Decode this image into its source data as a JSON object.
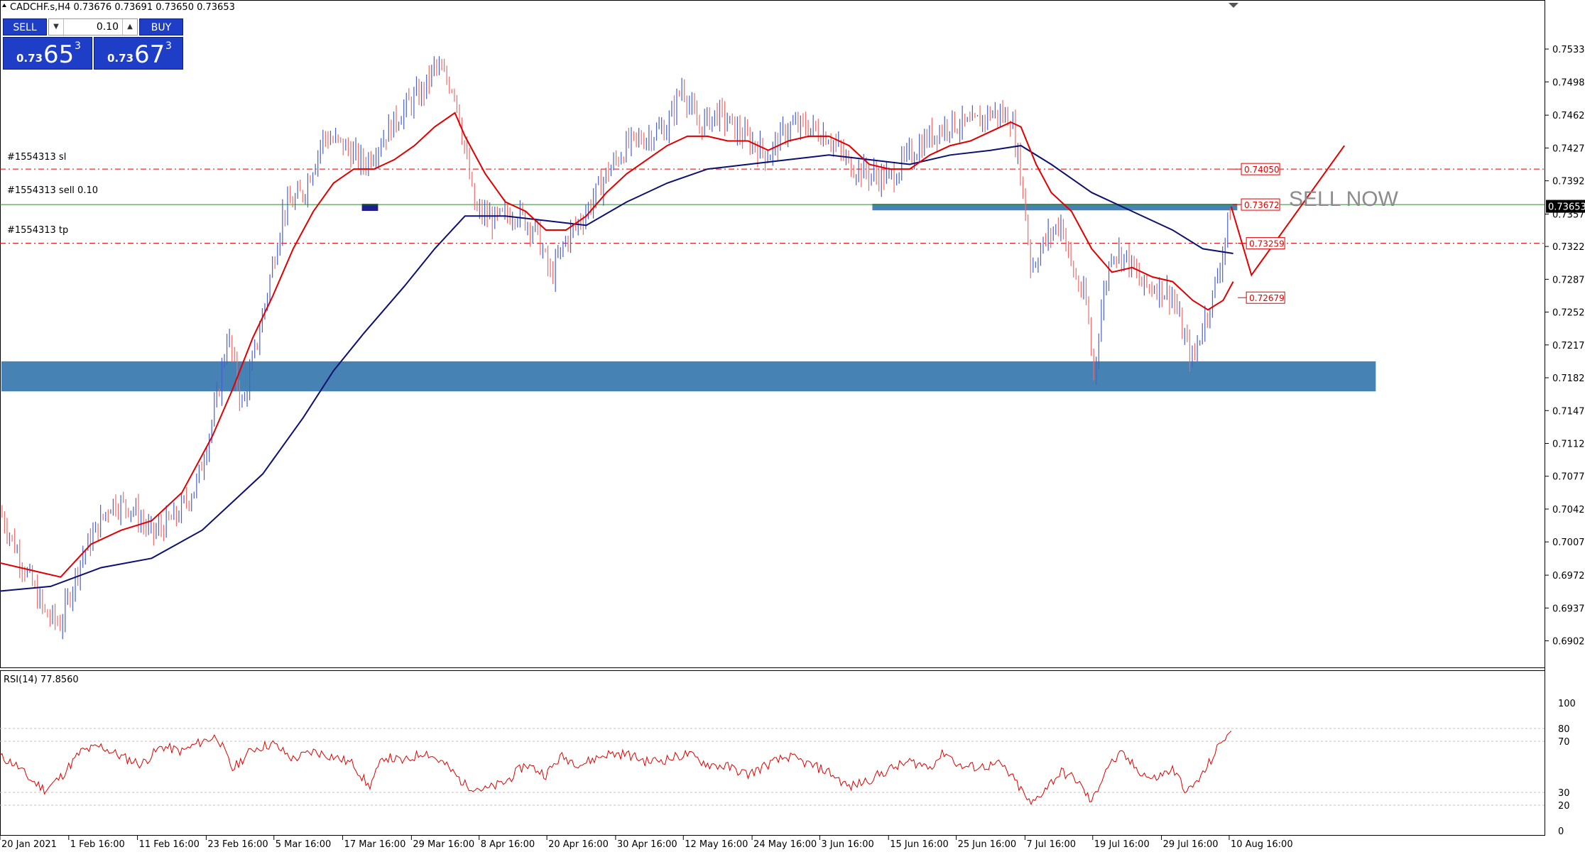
{
  "header": {
    "symbol_info": "CADCHF.s,H4  0.73676 0.73691 0.73650 0.73653"
  },
  "trade_panel": {
    "sell_label": "SELL",
    "buy_label": "BUY",
    "lot": "0.10",
    "sell_prefix": "0.73",
    "sell_big": "65",
    "sell_sup": "3",
    "buy_prefix": "0.73",
    "buy_big": "67",
    "buy_sup": "3"
  },
  "orders": {
    "sl_label": "#1554313 sl",
    "sell_label": "#1554313 sell 0.10",
    "tp_label": "#1554313 tp"
  },
  "annotations": {
    "sell_now": "SELL NOW",
    "tag_sl": "0.74050",
    "tag_entry": "0.73672",
    "tag_tp": "0.73259",
    "tag_low": "0.72679",
    "current_price": "0.73653"
  },
  "rsi": {
    "label": "RSI(14) 77.8560"
  },
  "colors": {
    "bull_candle": "#4a5fd0",
    "bear_candle": "#f06a6a",
    "ema_fast": "#e00000",
    "ma_slow": "#0c1070",
    "zone_blue": "#4682b4",
    "rsi_line": "#e00000",
    "current_price_bg": "#000000"
  },
  "chart_data": [
    {
      "type": "line",
      "subtype": "candlestick",
      "ylim": [
        0.6885,
        0.7555
      ],
      "y_ticks": [
        "0.75330",
        "0.74980",
        "0.74625",
        "0.74275",
        "0.73925",
        "0.73570",
        "0.73225",
        "0.72875",
        "0.72525",
        "0.72175",
        "0.71825",
        "0.71475",
        "0.71125",
        "0.70775",
        "0.70425",
        "0.70075",
        "0.69720",
        "0.69370",
        "0.69020"
      ],
      "x_ticks": [
        "20 Jan 2021",
        "1 Feb 16:00",
        "11 Feb 16:00",
        "23 Feb 16:00",
        "5 Mar 16:00",
        "17 Mar 16:00",
        "29 Mar 16:00",
        "8 Apr 16:00",
        "20 Apr 16:00",
        "30 Apr 16:00",
        "12 May 16:00",
        "24 May 16:00",
        "3 Jun 16:00",
        "15 Jun 16:00",
        "25 Jun 16:00",
        "7 Jul 16:00",
        "19 Jul 16:00",
        "29 Jul 16:00",
        "10 Aug 16:00"
      ],
      "price_path": [
        [
          0,
          0.704
        ],
        [
          20,
          0.699
        ],
        [
          45,
          0.693
        ],
        [
          60,
          0.692
        ],
        [
          80,
          0.699
        ],
        [
          110,
          0.705
        ],
        [
          130,
          0.7045
        ],
        [
          150,
          0.7015
        ],
        [
          175,
          0.7035
        ],
        [
          195,
          0.707
        ],
        [
          215,
          0.716
        ],
        [
          225,
          0.723
        ],
        [
          240,
          0.715
        ],
        [
          260,
          0.725
        ],
        [
          280,
          0.736
        ],
        [
          300,
          0.738
        ],
        [
          320,
          0.744
        ],
        [
          340,
          0.743
        ],
        [
          360,
          0.741
        ],
        [
          380,
          0.744
        ],
        [
          400,
          0.747
        ],
        [
          420,
          0.749
        ],
        [
          430,
          0.7515
        ],
        [
          450,
          0.749
        ],
        [
          470,
          0.736
        ],
        [
          490,
          0.735
        ],
        [
          510,
          0.736
        ],
        [
          530,
          0.734
        ],
        [
          545,
          0.729
        ],
        [
          560,
          0.733
        ],
        [
          580,
          0.736
        ],
        [
          600,
          0.74
        ],
        [
          620,
          0.743
        ],
        [
          640,
          0.744
        ],
        [
          660,
          0.745
        ],
        [
          675,
          0.7495
        ],
        [
          690,
          0.745
        ],
        [
          710,
          0.7465
        ],
        [
          730,
          0.7445
        ],
        [
          760,
          0.742
        ],
        [
          780,
          0.745
        ],
        [
          800,
          0.745
        ],
        [
          820,
          0.744
        ],
        [
          840,
          0.741
        ],
        [
          860,
          0.74
        ],
        [
          880,
          0.7395
        ],
        [
          900,
          0.742
        ],
        [
          920,
          0.744
        ],
        [
          940,
          0.7455
        ],
        [
          960,
          0.745
        ],
        [
          980,
          0.7465
        ],
        [
          1000,
          0.746
        ],
        [
          1010,
          0.74
        ],
        [
          1020,
          0.73
        ],
        [
          1035,
          0.733
        ],
        [
          1050,
          0.735
        ],
        [
          1060,
          0.73
        ],
        [
          1075,
          0.726
        ],
        [
          1082,
          0.7185
        ],
        [
          1090,
          0.726
        ],
        [
          1100,
          0.732
        ],
        [
          1115,
          0.731
        ],
        [
          1130,
          0.728
        ],
        [
          1145,
          0.728
        ],
        [
          1160,
          0.727
        ],
        [
          1170,
          0.723
        ],
        [
          1180,
          0.72
        ],
        [
          1190,
          0.724
        ],
        [
          1200,
          0.727
        ],
        [
          1210,
          0.732
        ],
        [
          1218,
          0.7365
        ]
      ],
      "ema_fast": [
        [
          0,
          0.6985
        ],
        [
          40,
          0.6975
        ],
        [
          60,
          0.697
        ],
        [
          90,
          0.7005
        ],
        [
          120,
          0.702
        ],
        [
          150,
          0.703
        ],
        [
          180,
          0.706
        ],
        [
          210,
          0.712
        ],
        [
          230,
          0.717
        ],
        [
          250,
          0.7225
        ],
        [
          270,
          0.727
        ],
        [
          290,
          0.732
        ],
        [
          310,
          0.736
        ],
        [
          330,
          0.739
        ],
        [
          350,
          0.7405
        ],
        [
          370,
          0.7405
        ],
        [
          390,
          0.7415
        ],
        [
          410,
          0.743
        ],
        [
          430,
          0.745
        ],
        [
          450,
          0.7465
        ],
        [
          460,
          0.744
        ],
        [
          480,
          0.74
        ],
        [
          500,
          0.737
        ],
        [
          520,
          0.736
        ],
        [
          540,
          0.734
        ],
        [
          560,
          0.734
        ],
        [
          580,
          0.7355
        ],
        [
          600,
          0.738
        ],
        [
          620,
          0.74
        ],
        [
          640,
          0.7415
        ],
        [
          660,
          0.743
        ],
        [
          680,
          0.744
        ],
        [
          700,
          0.744
        ],
        [
          720,
          0.7435
        ],
        [
          740,
          0.7435
        ],
        [
          760,
          0.7425
        ],
        [
          780,
          0.7435
        ],
        [
          800,
          0.744
        ],
        [
          820,
          0.744
        ],
        [
          840,
          0.743
        ],
        [
          860,
          0.741
        ],
        [
          880,
          0.7405
        ],
        [
          900,
          0.7405
        ],
        [
          920,
          0.742
        ],
        [
          940,
          0.743
        ],
        [
          960,
          0.7435
        ],
        [
          980,
          0.7445
        ],
        [
          1000,
          0.7455
        ],
        [
          1010,
          0.745
        ],
        [
          1025,
          0.741
        ],
        [
          1040,
          0.738
        ],
        [
          1060,
          0.736
        ],
        [
          1080,
          0.732
        ],
        [
          1100,
          0.7295
        ],
        [
          1120,
          0.73
        ],
        [
          1140,
          0.729
        ],
        [
          1160,
          0.7285
        ],
        [
          1180,
          0.7265
        ],
        [
          1195,
          0.7255
        ],
        [
          1210,
          0.7265
        ],
        [
          1220,
          0.7285
        ]
      ],
      "ma_slow": [
        [
          0,
          0.6955
        ],
        [
          50,
          0.696
        ],
        [
          100,
          0.698
        ],
        [
          150,
          0.699
        ],
        [
          200,
          0.702
        ],
        [
          230,
          0.705
        ],
        [
          260,
          0.708
        ],
        [
          300,
          0.714
        ],
        [
          330,
          0.719
        ],
        [
          360,
          0.723
        ],
        [
          400,
          0.728
        ],
        [
          430,
          0.732
        ],
        [
          460,
          0.7355
        ],
        [
          500,
          0.7355
        ],
        [
          540,
          0.735
        ],
        [
          580,
          0.7345
        ],
        [
          620,
          0.737
        ],
        [
          660,
          0.739
        ],
        [
          700,
          0.7405
        ],
        [
          740,
          0.741
        ],
        [
          780,
          0.7415
        ],
        [
          820,
          0.742
        ],
        [
          860,
          0.7415
        ],
        [
          900,
          0.741
        ],
        [
          940,
          0.742
        ],
        [
          980,
          0.7425
        ],
        [
          1010,
          0.743
        ],
        [
          1040,
          0.741
        ],
        [
          1080,
          0.738
        ],
        [
          1120,
          0.736
        ],
        [
          1160,
          0.734
        ],
        [
          1190,
          0.732
        ],
        [
          1220,
          0.7315
        ]
      ],
      "levels": {
        "sl": 0.7405,
        "entry": 0.73672,
        "tp": 0.73259,
        "current": 0.73653,
        "low_tag": 0.72679
      },
      "zones": [
        {
          "from": 0.7168,
          "to": 0.72
        },
        {
          "from": 0.7361,
          "to": 0.7368
        }
      ],
      "forecast_path": [
        [
          1218,
          0.7365
        ],
        [
          1238,
          0.7292
        ],
        [
          1330,
          0.743
        ]
      ]
    },
    {
      "type": "line",
      "name": "RSI(14)",
      "ylim": [
        0,
        100
      ],
      "y_ticks": [
        100,
        80,
        70,
        30,
        20,
        0
      ],
      "levels": [
        80,
        70,
        30,
        20
      ],
      "values_path": [
        [
          0,
          58
        ],
        [
          15,
          52
        ],
        [
          30,
          40
        ],
        [
          45,
          32
        ],
        [
          60,
          42
        ],
        [
          80,
          62
        ],
        [
          100,
          66
        ],
        [
          120,
          58
        ],
        [
          140,
          52
        ],
        [
          160,
          66
        ],
        [
          180,
          62
        ],
        [
          200,
          70
        ],
        [
          215,
          74
        ],
        [
          230,
          48
        ],
        [
          250,
          64
        ],
        [
          270,
          68
        ],
        [
          290,
          56
        ],
        [
          310,
          62
        ],
        [
          330,
          58
        ],
        [
          350,
          52
        ],
        [
          365,
          34
        ],
        [
          380,
          58
        ],
        [
          400,
          54
        ],
        [
          420,
          62
        ],
        [
          440,
          52
        ],
        [
          460,
          36
        ],
        [
          480,
          32
        ],
        [
          500,
          38
        ],
        [
          520,
          52
        ],
        [
          540,
          44
        ],
        [
          555,
          58
        ],
        [
          575,
          52
        ],
        [
          600,
          60
        ],
        [
          620,
          60
        ],
        [
          640,
          54
        ],
        [
          660,
          56
        ],
        [
          680,
          60
        ],
        [
          700,
          52
        ],
        [
          720,
          50
        ],
        [
          740,
          44
        ],
        [
          760,
          52
        ],
        [
          780,
          58
        ],
        [
          800,
          52
        ],
        [
          820,
          46
        ],
        [
          840,
          34
        ],
        [
          860,
          40
        ],
        [
          880,
          48
        ],
        [
          900,
          54
        ],
        [
          920,
          50
        ],
        [
          935,
          62
        ],
        [
          950,
          50
        ],
        [
          970,
          50
        ],
        [
          990,
          52
        ],
        [
          1005,
          38
        ],
        [
          1020,
          20
        ],
        [
          1035,
          34
        ],
        [
          1050,
          46
        ],
        [
          1065,
          40
        ],
        [
          1080,
          22
        ],
        [
          1095,
          50
        ],
        [
          1110,
          60
        ],
        [
          1125,
          48
        ],
        [
          1140,
          40
        ],
        [
          1160,
          48
        ],
        [
          1175,
          30
        ],
        [
          1190,
          44
        ],
        [
          1200,
          58
        ],
        [
          1210,
          72
        ],
        [
          1218,
          78
        ]
      ]
    }
  ]
}
